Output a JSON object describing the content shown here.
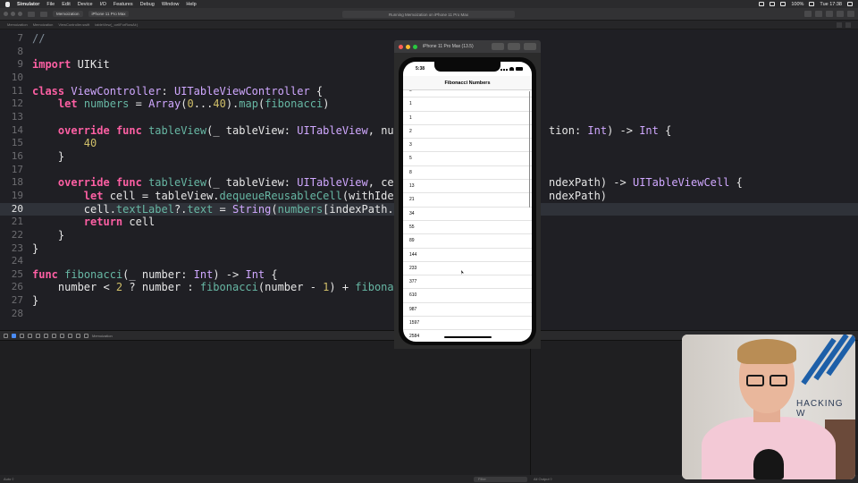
{
  "menubar": {
    "app_name": "Simulator",
    "items": [
      "File",
      "Edit",
      "Device",
      "I/O",
      "Features",
      "Debug",
      "Window",
      "Help"
    ],
    "battery": "100%",
    "clock": "Tue 17:38"
  },
  "toolbar": {
    "scheme": "Memoization",
    "destination": "iPhone 11 Pro Max",
    "status": "Running Memoization on iPhone 11 Pro Max"
  },
  "jumpbar": {
    "crumbs": [
      "Memoization",
      "Memoization",
      "ViewController.swift",
      "tableView(_:cellForRowAt:)"
    ]
  },
  "editor": {
    "current_line": 20,
    "lines": [
      {
        "n": "7",
        "html": "<span class=\"cm\">//</span>"
      },
      {
        "n": "8",
        "html": ""
      },
      {
        "n": "9",
        "html": "<span class=\"kw\">import</span> UIKit"
      },
      {
        "n": "10",
        "html": ""
      },
      {
        "n": "11",
        "html": "<span class=\"kw\">class</span> <span class=\"ty\">ViewController</span>: <span class=\"ty\">UITableViewController</span> {"
      },
      {
        "n": "12",
        "html": "    <span class=\"kw\">let</span> <span class=\"pr\">numbers</span> = <span class=\"ty\">Array</span>(<span class=\"num\">0</span>...<span class=\"num\">40</span>).<span class=\"pr\">map</span>(<span class=\"pr\">fibonacci</span>)"
      },
      {
        "n": "13",
        "html": ""
      },
      {
        "n": "14",
        "html": "    <span class=\"kw\">override</span> <span class=\"kw\">func</span> <span class=\"pr\">tableView</span>(_ tableView: <span class=\"ty\">UITableView</span>, num                       tion: <span class=\"ty\">Int</span>) -> <span class=\"ty\">Int</span> {"
      },
      {
        "n": "15",
        "html": "        <span class=\"num\">40</span>"
      },
      {
        "n": "16",
        "html": "    }"
      },
      {
        "n": "17",
        "html": ""
      },
      {
        "n": "18",
        "html": "    <span class=\"kw\">override</span> <span class=\"kw\">func</span> <span class=\"pr\">tableView</span>(_ tableView: <span class=\"ty\">UITableView</span>, cel                       ndexPath) -> <span class=\"ty\">UITableViewCell</span> {"
      },
      {
        "n": "19",
        "html": "        <span class=\"kw\">let</span> cell = tableView.<span class=\"pr\">dequeueReusableCell</span>(withIden                       ndexPath)"
      },
      {
        "n": "20",
        "html": "        cell.<span class=\"pr\">textLabel</span>?.<span class=\"pr\">text</span> = <span class=\"ty\">String</span>(<span class=\"pr\">numbers</span>[indexPath.r"
      },
      {
        "n": "21",
        "html": "        <span class=\"kw\">return</span> cell"
      },
      {
        "n": "22",
        "html": "    }"
      },
      {
        "n": "23",
        "html": "}"
      },
      {
        "n": "24",
        "html": ""
      },
      {
        "n": "25",
        "html": "<span class=\"kw\">func</span> <span class=\"pr\">fibonacci</span>(_ number: <span class=\"ty\">Int</span>) -> <span class=\"ty\">Int</span> {"
      },
      {
        "n": "26",
        "html": "    number < <span class=\"num\">2</span> ? number : <span class=\"pr\">fibonacci</span>(number - <span class=\"num\">1</span>) + <span class=\"pr\">fibonac</span>"
      },
      {
        "n": "27",
        "html": "}"
      },
      {
        "n": "28",
        "html": ""
      }
    ]
  },
  "debugbar": {
    "target": "Memoization"
  },
  "debugarea": {
    "auto_label": "Auto ◊",
    "filter_placeholder": "Filter",
    "output_label": "All Output ◊"
  },
  "simulator": {
    "title": "iPhone 11 Pro Max (13.5)",
    "status_time": "5:38",
    "nav_title": "Fibonacci Numbers",
    "cells": [
      "0",
      "1",
      "1",
      "2",
      "3",
      "5",
      "8",
      "13",
      "21",
      "34",
      "55",
      "89",
      "144",
      "233",
      "377",
      "610",
      "987",
      "1597",
      "2584"
    ]
  },
  "webcam": {
    "wall_text": "HACKING W"
  },
  "colors": {
    "keyword": "#fc5fa3",
    "type": "#d0a8ff",
    "project_symbol": "#67b7a4",
    "number": "#d0bf69",
    "editor_bg": "#1f1f24"
  }
}
